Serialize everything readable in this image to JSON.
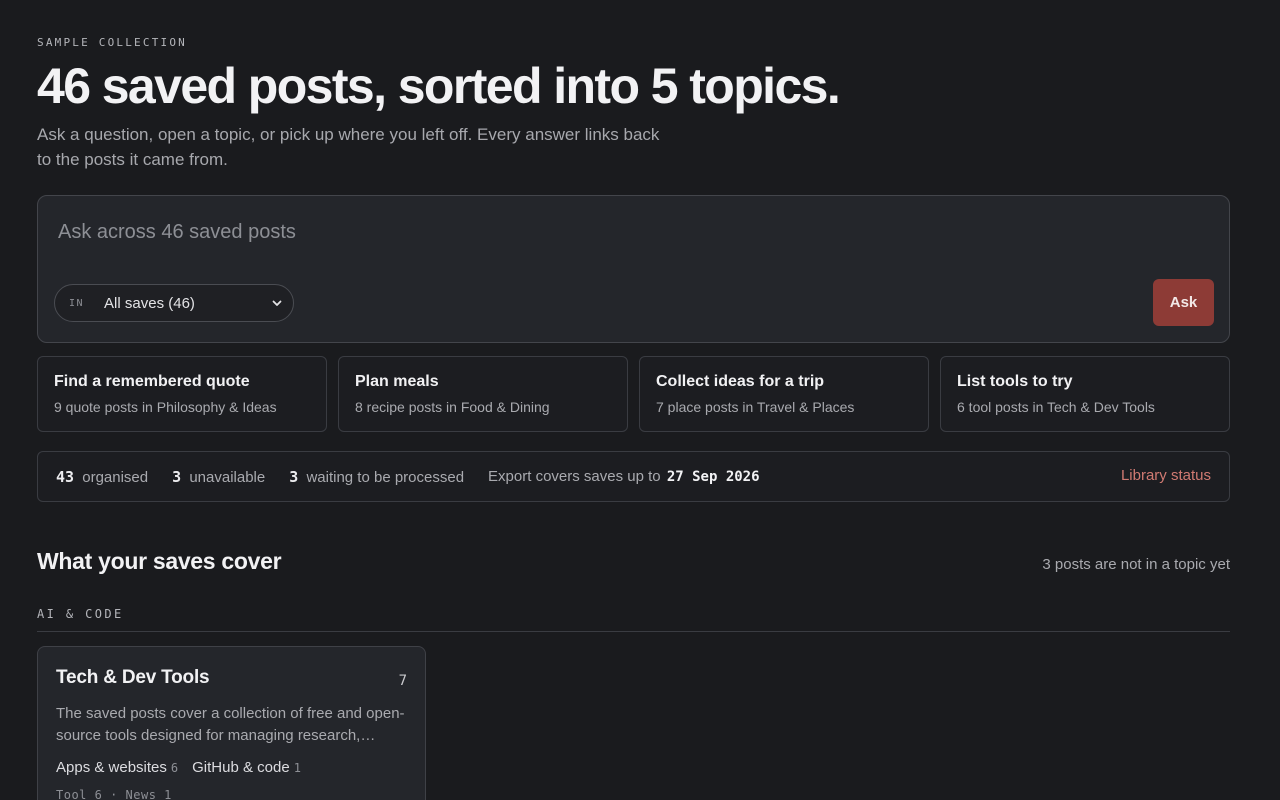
{
  "header": {
    "eyebrow": "SAMPLE COLLECTION",
    "headline": "46 saved posts, sorted into 5 topics.",
    "subhead": "Ask a question, open a topic, or pick up where you left off. Every answer links back to the posts it came from."
  },
  "ask": {
    "placeholder": "Ask across 46 saved posts",
    "scope_prefix": "IN",
    "scope_value": "All saves (46)",
    "button_label": "Ask"
  },
  "suggestions": [
    {
      "title": "Find a remembered quote",
      "desc": "9 quote posts in Philosophy & Ideas"
    },
    {
      "title": "Plan meals",
      "desc": "8 recipe posts in Food & Dining"
    },
    {
      "title": "Collect ideas for a trip",
      "desc": "7 place posts in Travel & Places"
    },
    {
      "title": "List tools to try",
      "desc": "6 tool posts in Tech & Dev Tools"
    }
  ],
  "status": {
    "organised_count": "43",
    "organised_label": "organised",
    "unavailable_count": "3",
    "unavailable_label": "unavailable",
    "waiting_count": "3",
    "waiting_label": "waiting to be processed",
    "export_label": "Export covers saves up to",
    "export_date": "27 Sep 2026",
    "library_link": "Library status"
  },
  "section": {
    "title": "What your saves cover",
    "note": "3 posts are not in a topic yet",
    "group_label": "AI & CODE"
  },
  "topics": [
    {
      "name": "Tech & Dev Tools",
      "count": "7",
      "desc": "The saved posts cover a collection of free and open-source tools designed for managing research, editing and more.",
      "subtopics": [
        {
          "label": "Apps & websites",
          "count": "6"
        },
        {
          "label": "GitHub & code",
          "count": "1"
        }
      ],
      "types": "Tool 6 · News 1"
    }
  ],
  "colors": {
    "background": "#1a1b1e",
    "accent": "#8d3b36",
    "link": "#d07a72"
  }
}
